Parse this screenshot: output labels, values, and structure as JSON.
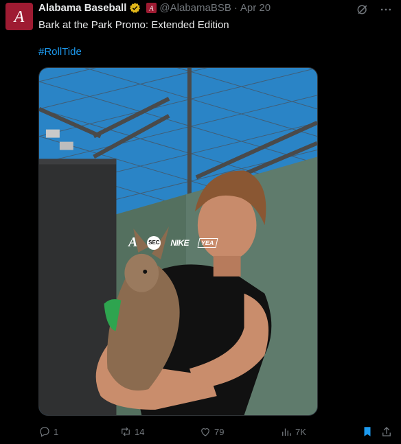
{
  "tweet": {
    "author_name": "Alabama Baseball",
    "handle": "@AlabamaBSB",
    "separator": "·",
    "date": "Apr 20",
    "text": "Bark at the Park Promo: Extended Edition",
    "hashtag": "#RollTide",
    "media_logos": [
      "A",
      "SEC",
      "NIKE",
      "YEA"
    ],
    "icons": {
      "avatar": "alabama-script-a-logo",
      "verified": "gold-verified-badge",
      "affiliate": "alabama-affiliate-badge",
      "grok": "grok-icon",
      "more": "more-icon"
    }
  },
  "actions": {
    "reply_count": "1",
    "retweet_count": "14",
    "like_count": "79",
    "view_count": "7K"
  },
  "colors": {
    "background": "#000000",
    "text": "#e7e9ea",
    "muted": "#71767b",
    "link": "#1d9bf0",
    "brand": "#9e1b32",
    "verified": "#e2b719",
    "bookmark": "#1d9bf0"
  }
}
